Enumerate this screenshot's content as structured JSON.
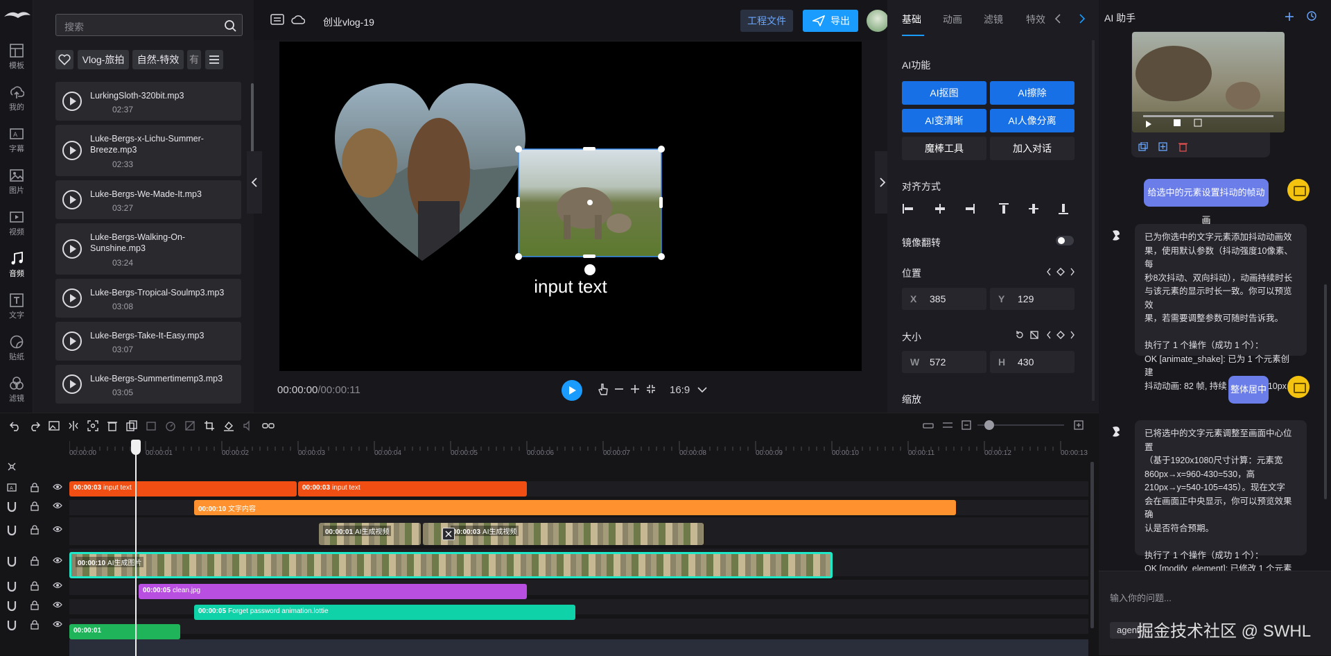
{
  "rail": {
    "items": [
      {
        "label": "模板",
        "icon": "template-icon"
      },
      {
        "label": "我的",
        "icon": "upload-cloud-icon"
      },
      {
        "label": "字幕",
        "icon": "subtitle-icon"
      },
      {
        "label": "图片",
        "icon": "image-icon"
      },
      {
        "label": "视频",
        "icon": "video-icon"
      },
      {
        "label": "音频",
        "icon": "music-icon"
      },
      {
        "label": "文字",
        "icon": "text-icon"
      },
      {
        "label": "贴纸",
        "icon": "sticker-icon"
      },
      {
        "label": "滤镜",
        "icon": "filter-icon"
      }
    ],
    "active": "音频"
  },
  "resources": {
    "search_placeholder": "搜索",
    "chips": [
      "Vlog-旅拍",
      "自然-特效",
      "有"
    ],
    "items": [
      {
        "name": "LurkingSloth-320bit.mp3",
        "duration": "02:37"
      },
      {
        "name": "Luke-Bergs-x-Lichu-Summer-Breeze.mp3",
        "duration": "02:33"
      },
      {
        "name": "Luke-Bergs-We-Made-It.mp3",
        "duration": "03:27"
      },
      {
        "name": "Luke-Bergs-Walking-On-Sunshine.mp3",
        "duration": "03:24"
      },
      {
        "name": "Luke-Bergs-Tropical-Soulmp3.mp3",
        "duration": "03:08"
      },
      {
        "name": "Luke-Bergs-Take-It-Easy.mp3",
        "duration": "03:07"
      },
      {
        "name": "Luke-Bergs-Summertimemp3.mp3",
        "duration": "03:05"
      }
    ]
  },
  "topbar": {
    "project_title": "创业vlog-19",
    "project_files": "工程文件",
    "export": "导出"
  },
  "preview": {
    "overlay_text": "input text",
    "current_time": "00:00:00",
    "total_time": "/00:00:11",
    "aspect": "16:9"
  },
  "props": {
    "tabs": [
      "基础",
      "动画",
      "滤镜",
      "特效"
    ],
    "active_tab": "基础",
    "ai_section": "AI功能",
    "ai_buttons": [
      "AI抠图",
      "AI擦除",
      "AI变清晰",
      "AI人像分离"
    ],
    "tool_buttons": [
      "魔棒工具",
      "加入对话"
    ],
    "align_section": "对齐方式",
    "mirror_section": "镜像翻转",
    "position_section": "位置",
    "x_key": "X",
    "x_value": "385",
    "y_key": "Y",
    "y_value": "129",
    "size_section": "大小",
    "w_key": "W",
    "w_value": "572",
    "h_key": "H",
    "h_value": "430",
    "scale_section": "缩放"
  },
  "chat": {
    "title": "AI 助手",
    "user_msg_1": "给选中的元素设置抖动的帧动画",
    "bot_msg_1": [
      "已为你选中的文字元素添加抖动动画效",
      "果，使用默认参数（抖动强度10像素、每",
      "秒8次抖动、双向抖动），动画持续时长",
      "与该元素的显示时长一致。你可以预览效",
      "果，若需要调整参数可随时告诉我。",
      "",
      "执行了 1 个操作（成功 1 个）：",
      "OK [animate_shake]: 已为 1 个元素创建",
      "抖动动画: 82 帧, 持续 10s, 强度 10px"
    ],
    "user_msg_2": "整体居中",
    "bot_msg_2": [
      "已将选中的文字元素调整至画面中心位置",
      "（基于1920x1080尺寸计算：元素宽",
      "860px→x=960-430=530，高",
      "210px→y=540-105=435）。现在文字",
      "会在画面正中央显示，你可以预览效果确",
      "认是否符合预期。",
      "",
      "执行了 1 个操作（成功 1 个）：",
      "OK [modify_element]: 已修改 1 个元素"
    ],
    "input_placeholder": "输入你的问题...",
    "agent_label": "agent"
  },
  "timeline": {
    "ticks": [
      "00:00:00",
      "00:00:01",
      "00:00:02",
      "00:00:03",
      "00:00:04",
      "00:00:05",
      "00:00:06",
      "00:00:07",
      "00:00:08",
      "00:00:09",
      "00:00:10",
      "00:00:11",
      "00:00:12",
      "00:00:13"
    ],
    "clips": {
      "text1": {
        "time": "00:00:03",
        "name": "input text"
      },
      "text2": {
        "time": "00:00:03",
        "name": "input text"
      },
      "subtitle": {
        "time": "00:00:10",
        "name": "文字内容"
      },
      "video1": {
        "time": "00:00:01",
        "name": "AI生成视频"
      },
      "video2": {
        "time": "00:00:03",
        "name": "AI生成视频"
      },
      "main_video": {
        "time": "00:00:10",
        "name": "AI生成图片"
      },
      "image": {
        "time": "00:00:05",
        "name": "clean.jpg"
      },
      "lottie": {
        "time": "00:00:05",
        "name": "Forget password animation.lottie"
      },
      "audio": {
        "time": "00:00:01",
        "name": ""
      }
    }
  },
  "watermark": "掘金技术社区 @ SWHL",
  "colors": {
    "accent": "#1a9cff",
    "ai_button": "#1770e6",
    "text_clip": "#f04e12",
    "subtitle_clip": "#ff922e",
    "image_clip": "#b84fe0",
    "lottie_clip": "#10d2a8",
    "audio_clip": "#1fb45a",
    "selected_clip_border": "#1ee8c8"
  }
}
